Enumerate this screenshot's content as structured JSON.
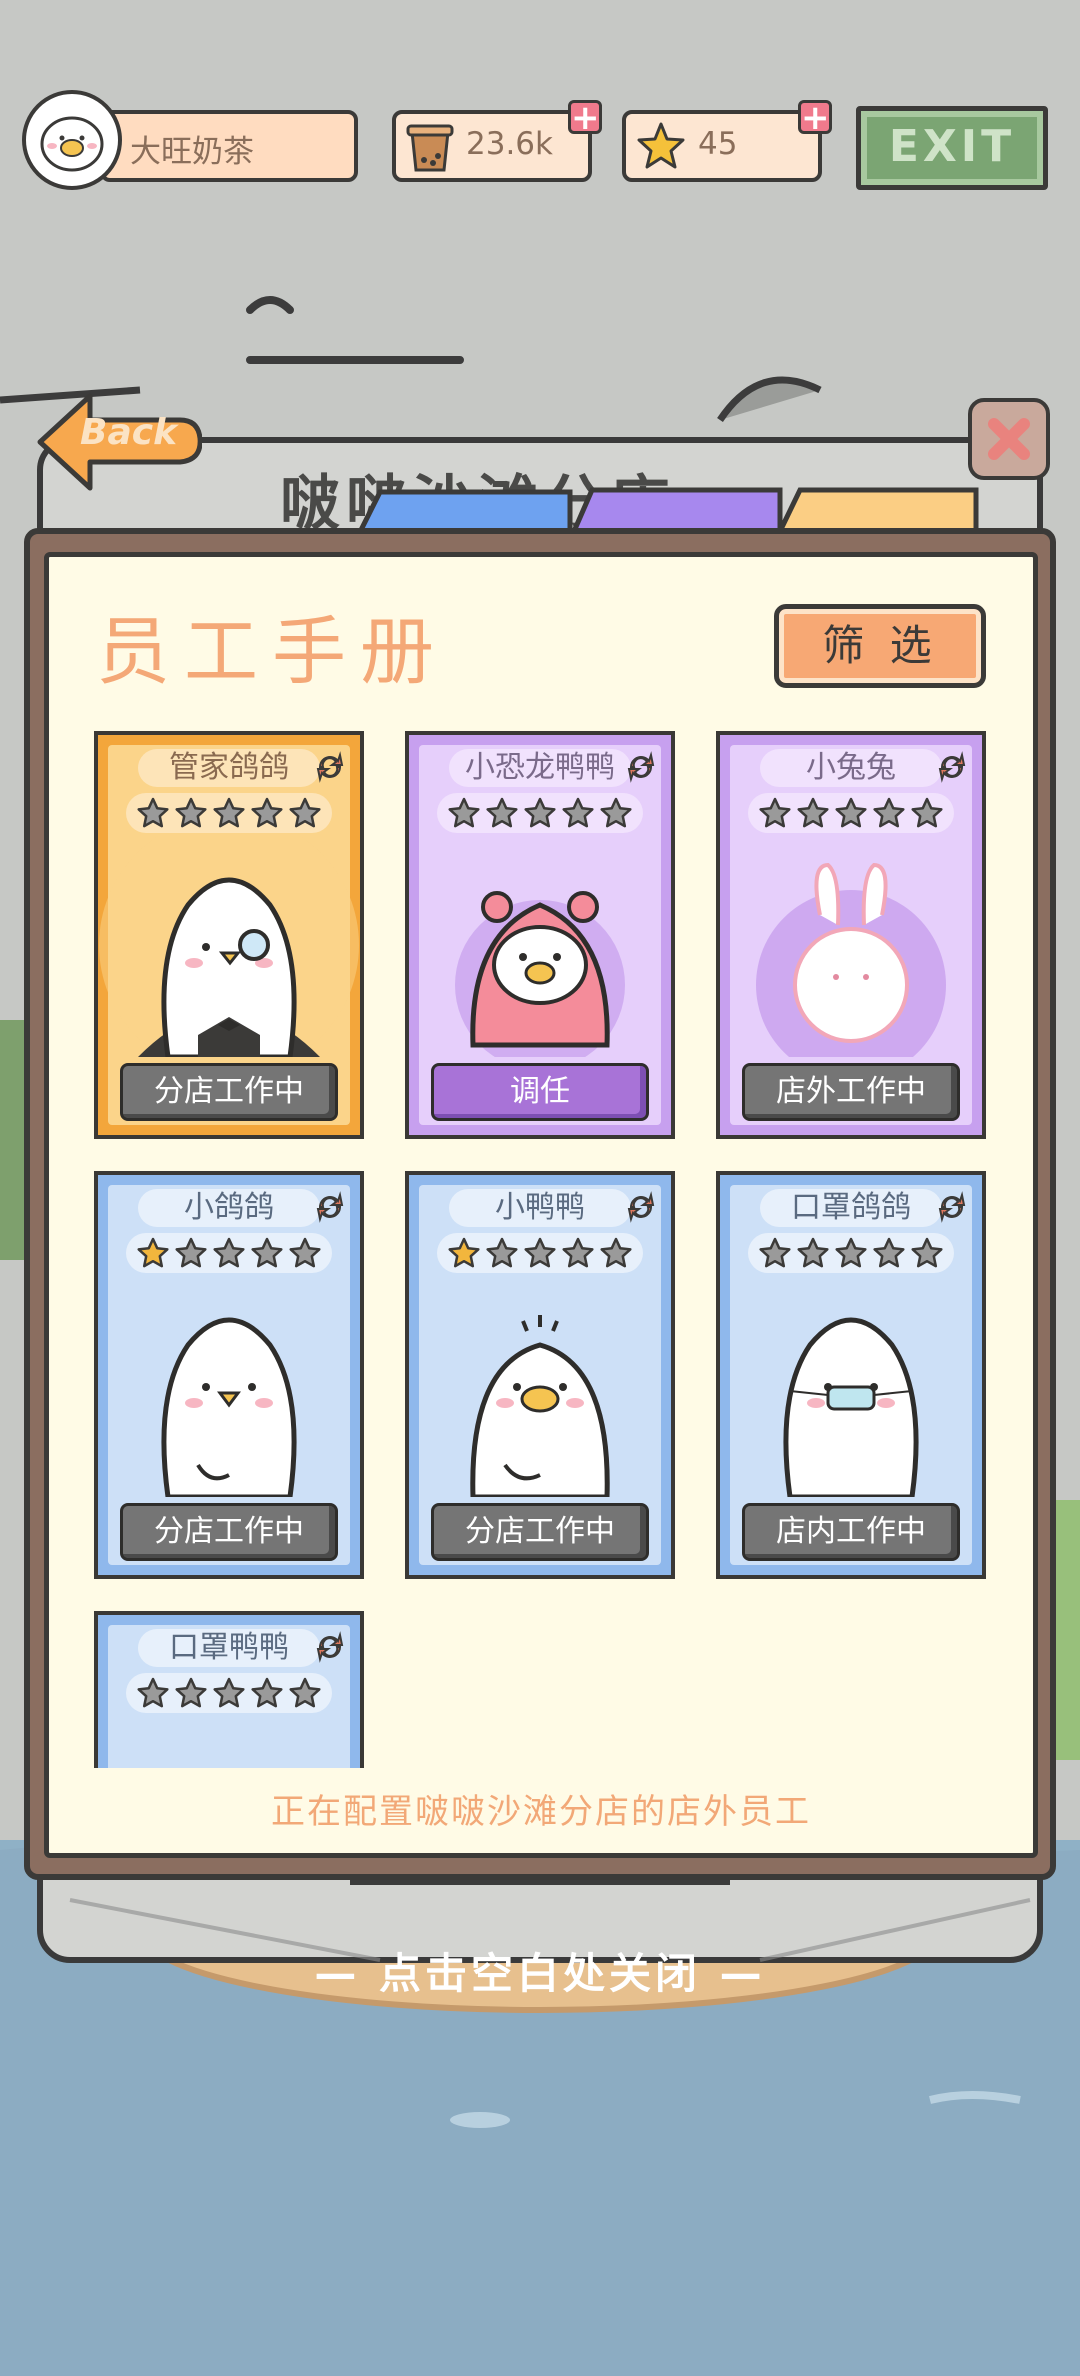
{
  "header": {
    "player_name": "大旺奶茶",
    "tea_count": "23.6k",
    "star_count": "45",
    "exit_label": "EXIT"
  },
  "nav": {
    "back_label": "Back",
    "bg_store_title": "啵啵沙滩分店"
  },
  "panel": {
    "title": "员工手册",
    "filter_label": "筛 选",
    "footer_text": "正在配置啵啵沙滩分店的店外员工",
    "close_hint": "— 点击空白处关闭 —"
  },
  "staff": [
    {
      "name": "管家鸽鸽",
      "stars": 0,
      "status": "分店工作中",
      "theme": "gold",
      "character": "butler-pigeon"
    },
    {
      "name": "小恐龙鸭鸭",
      "stars": 0,
      "status": "调任",
      "theme": "purple",
      "character": "dino-duck"
    },
    {
      "name": "小兔兔",
      "stars": 0,
      "status": "店外工作中",
      "theme": "purple",
      "character": "bunny"
    },
    {
      "name": "小鸽鸽",
      "stars": 1,
      "status": "分店工作中",
      "theme": "blue",
      "character": "pigeon"
    },
    {
      "name": "小鸭鸭",
      "stars": 1,
      "status": "分店工作中",
      "theme": "blue",
      "character": "duck"
    },
    {
      "name": "口罩鸽鸽",
      "stars": 0,
      "status": "店内工作中",
      "theme": "blue",
      "character": "masked-pigeon"
    },
    {
      "name": "口罩鸭鸭",
      "stars": 0,
      "status": "",
      "theme": "blue",
      "character": "masked-duck"
    }
  ],
  "colors": {
    "gold_card": "#f5a73a",
    "purple_card": "#c9a2ee",
    "blue_card": "#b8d4f2",
    "panel_bg": "#fffbe6",
    "title_orange": "#f2a877",
    "star_filled": "#f2b63d",
    "star_empty": "#9a9a9a"
  }
}
